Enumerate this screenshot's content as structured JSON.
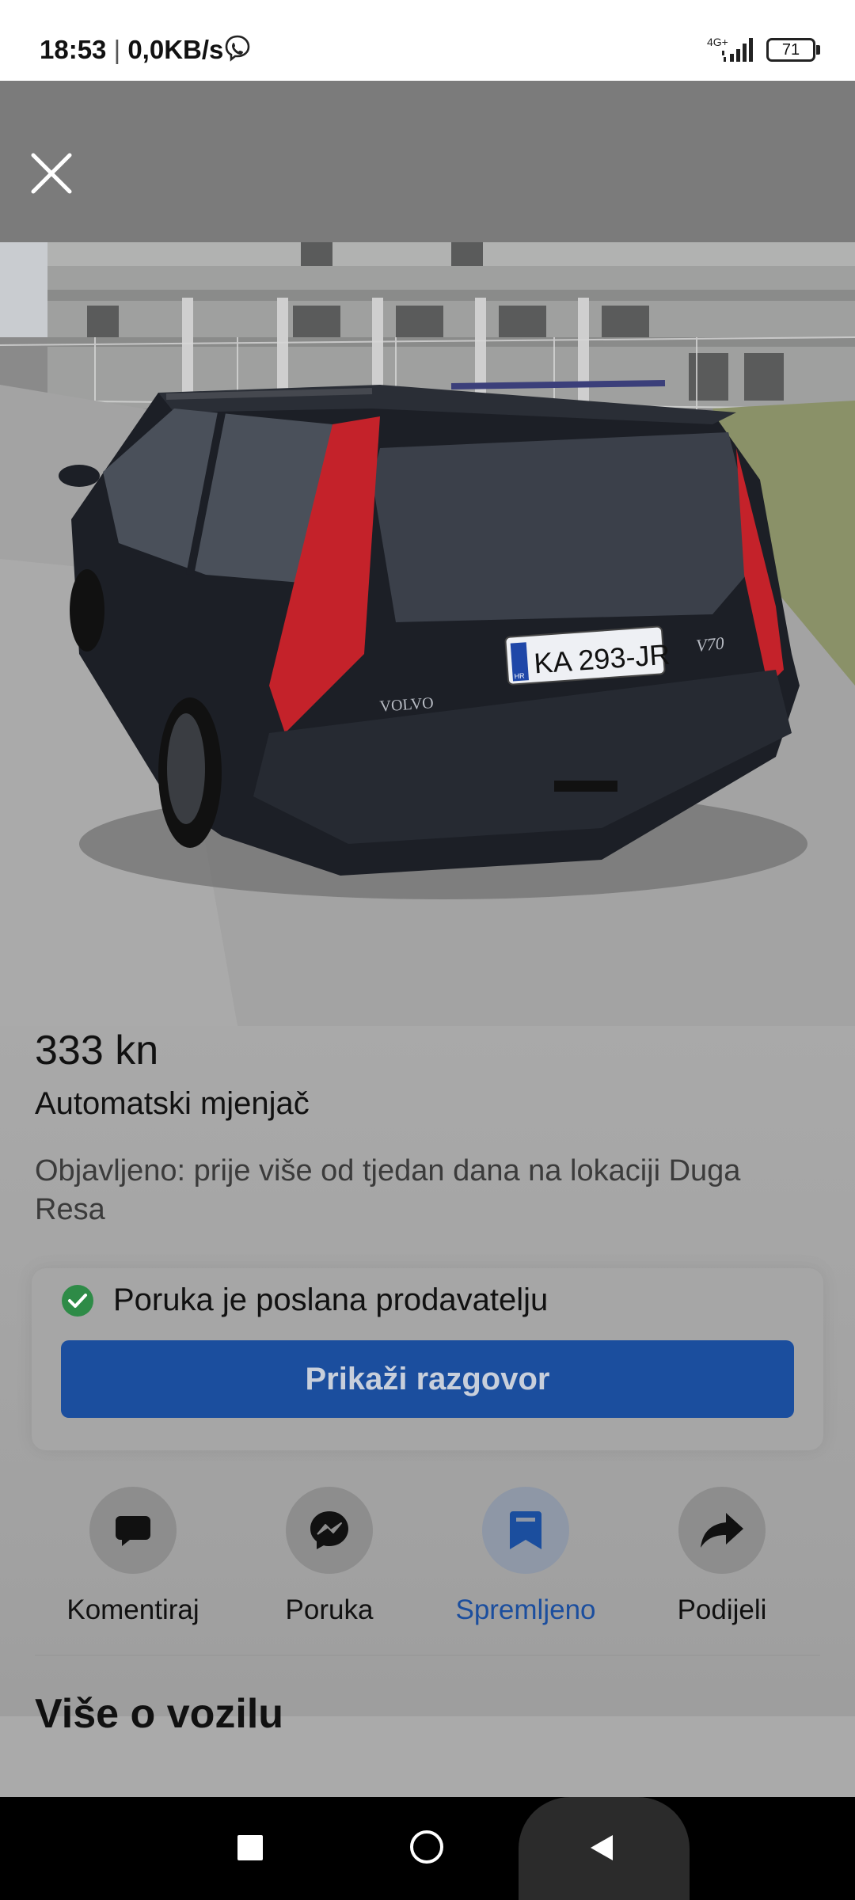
{
  "status_bar": {
    "time": "18:53",
    "separator": "|",
    "speed": "0,0KB/s",
    "network": "4G+",
    "battery": "71"
  },
  "listing": {
    "price": "333 kn",
    "transmission": "Automatski mjenjač",
    "posted": "Objavljeno: prije više od tjedan dana na lokaciji Duga Resa",
    "plate": "KA 293-JR",
    "plate_country": "HR",
    "brand_badge": "VOLVO",
    "model_badge": "V70"
  },
  "message_card": {
    "status_text": "Poruka je poslana prodavatelju",
    "button_label": "Prikaži razgovor"
  },
  "actions": [
    {
      "label": "Komentiraj",
      "icon": "comment-icon"
    },
    {
      "label": "Poruka",
      "icon": "messenger-icon"
    },
    {
      "label": "Spremljeno",
      "icon": "bookmark-icon"
    },
    {
      "label": "Podijeli",
      "icon": "share-icon"
    }
  ],
  "section": {
    "title": "Više o vozilu"
  },
  "colors": {
    "accent": "#1b4e9e",
    "success": "#2e8b47",
    "overlay": "#7b7b7b"
  }
}
